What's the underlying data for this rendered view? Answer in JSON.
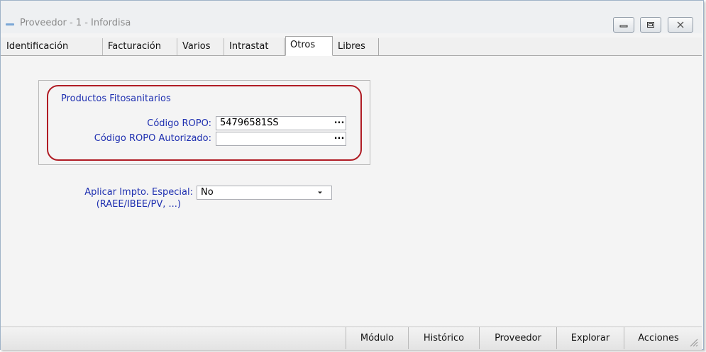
{
  "window": {
    "title": "Proveedor - 1 - Infordisa",
    "controls": [
      "minimize-icon",
      "maximize-icon",
      "close-icon"
    ]
  },
  "tabs": [
    {
      "label": "Identificación",
      "active": false
    },
    {
      "label": "Facturación",
      "active": false
    },
    {
      "label": "Varios",
      "active": false
    },
    {
      "label": "Intrastat",
      "active": false
    },
    {
      "label": "Otros",
      "active": true
    },
    {
      "label": "Libres",
      "active": false
    }
  ],
  "fitosanitarios": {
    "title": "Productos Fitosanitarios",
    "codigo_ropo_label": "Código ROPO:",
    "codigo_ropo_value": "54796581SS",
    "codigo_ropo_autorizado_label": "Código ROPO Autorizado:",
    "codigo_ropo_autorizado_value": "",
    "lookup_label": "..."
  },
  "impuesto": {
    "label_line1": "Aplicar Impto. Especial:",
    "label_line2": "(RAEE/IBEE/PV, ...)",
    "selected": "No"
  },
  "bottom_buttons": [
    "Módulo",
    "Histórico",
    "Proveedor",
    "Explorar",
    "Acciones"
  ],
  "colors": {
    "label_blue": "#1e2fb0",
    "highlight_red": "#b01c24",
    "title_gray": "#8a8a8a"
  }
}
